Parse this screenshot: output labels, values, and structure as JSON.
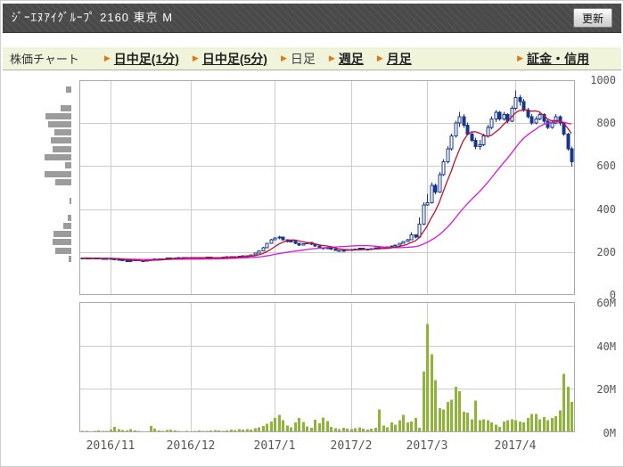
{
  "header": {
    "title": "ｼﾞｰｴﾇｱｲｸﾞﾙｰﾌﾟ 2160 東京 M",
    "refresh_label": "更新"
  },
  "nav": {
    "label": "株価チャート",
    "items": [
      {
        "label": "日中足(1分)",
        "current": false
      },
      {
        "label": "日中足(5分)",
        "current": false
      },
      {
        "label": "日足",
        "current": true
      },
      {
        "label": "週足",
        "current": false
      },
      {
        "label": "月足",
        "current": false
      },
      {
        "label": "証金・信用",
        "current": false
      }
    ]
  },
  "chart_data": {
    "type": "candlestick",
    "title": "",
    "price_axis": {
      "range": [
        0,
        1000
      ],
      "ticks": [
        1000,
        800,
        600,
        400,
        200,
        0
      ],
      "position": "right"
    },
    "volume_axis": {
      "range_millions": [
        0,
        60
      ],
      "ticks": [
        "60M",
        "40M",
        "20M",
        "0M"
      ],
      "tick_values": [
        60,
        40,
        20,
        0
      ],
      "position": "right"
    },
    "x_axis": {
      "month_ticks": [
        {
          "label": "2016/11",
          "index": 7
        },
        {
          "label": "2016/12",
          "index": 27
        },
        {
          "label": "2017/1",
          "index": 48
        },
        {
          "label": "2017/2",
          "index": 67
        },
        {
          "label": "2017/3",
          "index": 86
        },
        {
          "label": "2017/4",
          "index": 108
        }
      ]
    },
    "grid": true,
    "ma_short_window": 7,
    "ma_long_window": 26,
    "colors": {
      "candle": "#17378f",
      "candle_up_fill": "#ffffff",
      "ma_short": "#bb1135",
      "ma_long": "#d818d8",
      "volume_bar": "#8eb43a",
      "hist_bar": "#9c9c9c",
      "grid": "#cccccc",
      "border": "#aaaaaa",
      "axis_text": "#555555"
    },
    "ohlc": [
      [
        172,
        174,
        169,
        171
      ],
      [
        171,
        174,
        168,
        173
      ],
      [
        173,
        174,
        168,
        170
      ],
      [
        170,
        174,
        169,
        172
      ],
      [
        172,
        175,
        168,
        170
      ],
      [
        170,
        172,
        166,
        168
      ],
      [
        168,
        172,
        167,
        171
      ],
      [
        171,
        172,
        167,
        169
      ],
      [
        169,
        170,
        164,
        166
      ],
      [
        166,
        167,
        161,
        163
      ],
      [
        163,
        164,
        157,
        159
      ],
      [
        159,
        160,
        154,
        157
      ],
      [
        157,
        161,
        155,
        160
      ],
      [
        160,
        164,
        159,
        163
      ],
      [
        163,
        164,
        158,
        160
      ],
      [
        160,
        161,
        156,
        158
      ],
      [
        158,
        162,
        157,
        161
      ],
      [
        161,
        166,
        160,
        165
      ],
      [
        165,
        169,
        164,
        168
      ],
      [
        168,
        169,
        163,
        165
      ],
      [
        165,
        170,
        164,
        169
      ],
      [
        169,
        173,
        168,
        172
      ],
      [
        172,
        173,
        167,
        169
      ],
      [
        169,
        174,
        168,
        173
      ],
      [
        173,
        176,
        172,
        175
      ],
      [
        175,
        176,
        170,
        172
      ],
      [
        172,
        176,
        171,
        175
      ],
      [
        175,
        176,
        171,
        173
      ],
      [
        173,
        177,
        172,
        175
      ],
      [
        175,
        176,
        170,
        172
      ],
      [
        172,
        175,
        171,
        174
      ],
      [
        174,
        178,
        173,
        176
      ],
      [
        176,
        177,
        172,
        174
      ],
      [
        174,
        175,
        169,
        171
      ],
      [
        171,
        175,
        170,
        174
      ],
      [
        174,
        178,
        173,
        177
      ],
      [
        177,
        181,
        176,
        179
      ],
      [
        179,
        180,
        174,
        176
      ],
      [
        176,
        180,
        175,
        178
      ],
      [
        178,
        182,
        177,
        180
      ],
      [
        180,
        185,
        179,
        183
      ],
      [
        183,
        184,
        178,
        181
      ],
      [
        181,
        188,
        180,
        186
      ],
      [
        186,
        196,
        185,
        194
      ],
      [
        194,
        208,
        193,
        205
      ],
      [
        205,
        224,
        204,
        220
      ],
      [
        220,
        243,
        219,
        240
      ],
      [
        240,
        262,
        238,
        258
      ],
      [
        258,
        270,
        255,
        265
      ],
      [
        265,
        275,
        260,
        270
      ],
      [
        270,
        272,
        254,
        258
      ],
      [
        258,
        260,
        244,
        248
      ],
      [
        248,
        256,
        245,
        252
      ],
      [
        252,
        253,
        237,
        240
      ],
      [
        240,
        242,
        228,
        232
      ],
      [
        232,
        240,
        230,
        238
      ],
      [
        238,
        247,
        236,
        244
      ],
      [
        244,
        245,
        233,
        236
      ],
      [
        236,
        237,
        225,
        228
      ],
      [
        228,
        229,
        217,
        220
      ],
      [
        220,
        222,
        212,
        215
      ],
      [
        215,
        222,
        213,
        219
      ],
      [
        219,
        220,
        210,
        213
      ],
      [
        213,
        214,
        205,
        208
      ],
      [
        208,
        209,
        201,
        204
      ],
      [
        204,
        210,
        203,
        208
      ],
      [
        208,
        214,
        206,
        212
      ],
      [
        212,
        213,
        207,
        210
      ],
      [
        210,
        215,
        208,
        213
      ],
      [
        213,
        219,
        212,
        217
      ],
      [
        217,
        218,
        211,
        214
      ],
      [
        214,
        215,
        208,
        211
      ],
      [
        211,
        217,
        210,
        215
      ],
      [
        215,
        221,
        214,
        219
      ],
      [
        219,
        220,
        213,
        216
      ],
      [
        216,
        222,
        215,
        220
      ],
      [
        220,
        226,
        219,
        224
      ],
      [
        224,
        230,
        223,
        228
      ],
      [
        228,
        235,
        227,
        233
      ],
      [
        233,
        242,
        232,
        240
      ],
      [
        240,
        250,
        238,
        248
      ],
      [
        248,
        261,
        247,
        258
      ],
      [
        258,
        292,
        256,
        280
      ],
      [
        280,
        283,
        264,
        270
      ],
      [
        270,
        360,
        266,
        330
      ],
      [
        330,
        432,
        326,
        420
      ],
      [
        420,
        470,
        415,
        430
      ],
      [
        430,
        525,
        425,
        510
      ],
      [
        510,
        518,
        468,
        480
      ],
      [
        480,
        572,
        476,
        560
      ],
      [
        560,
        632,
        554,
        620
      ],
      [
        620,
        692,
        612,
        680
      ],
      [
        680,
        752,
        672,
        740
      ],
      [
        740,
        812,
        732,
        800
      ],
      [
        800,
        852,
        782,
        830
      ],
      [
        830,
        842,
        778,
        790
      ],
      [
        790,
        802,
        742,
        750
      ],
      [
        750,
        762,
        712,
        720
      ],
      [
        720,
        732,
        678,
        690
      ],
      [
        690,
        722,
        676,
        700
      ],
      [
        700,
        752,
        692,
        740
      ],
      [
        740,
        792,
        732,
        780
      ],
      [
        780,
        832,
        772,
        820
      ],
      [
        820,
        862,
        806,
        850
      ],
      [
        850,
        856,
        812,
        820
      ],
      [
        820,
        852,
        812,
        840
      ],
      [
        840,
        846,
        798,
        810
      ],
      [
        810,
        882,
        804,
        870
      ],
      [
        870,
        953,
        862,
        920
      ],
      [
        920,
        932,
        882,
        900
      ],
      [
        900,
        912,
        852,
        860
      ],
      [
        860,
        872,
        822,
        830
      ],
      [
        830,
        842,
        792,
        800
      ],
      [
        800,
        832,
        794,
        820
      ],
      [
        820,
        852,
        814,
        840
      ],
      [
        840,
        846,
        798,
        810
      ],
      [
        810,
        816,
        772,
        780
      ],
      [
        780,
        812,
        774,
        800
      ],
      [
        800,
        842,
        794,
        830
      ],
      [
        830,
        836,
        788,
        800
      ],
      [
        800,
        806,
        740,
        750
      ],
      [
        750,
        756,
        672,
        680
      ],
      [
        680,
        690,
        598,
        620
      ]
    ],
    "volumes_millions": [
      0.6,
      0.7,
      0.5,
      0.6,
      0.9,
      0.7,
      0.6,
      1.2,
      2.4,
      1.5,
      1.0,
      0.8,
      1.4,
      0.9,
      0.7,
      0.5,
      0.4,
      2.8,
      1.6,
      0.9,
      0.7,
      1.0,
      1.2,
      0.8,
      0.6,
      0.5,
      0.7,
      0.5,
      0.6,
      0.8,
      0.7,
      0.6,
      0.9,
      1.1,
      0.8,
      0.6,
      0.9,
      1.2,
      1.0,
      1.4,
      1.2,
      1.5,
      1.3,
      1.8,
      2.2,
      2.8,
      4.0,
      5.0,
      6.5,
      8.0,
      5.5,
      3.0,
      2.2,
      4.5,
      6.5,
      4.8,
      2.6,
      2.0,
      5.8,
      4.2,
      6.8,
      5.2,
      2.4,
      1.8,
      1.5,
      2.0,
      1.6,
      1.4,
      1.8,
      2.2,
      1.6,
      1.3,
      1.7,
      2.1,
      10.5,
      3.0,
      2.2,
      4.5,
      3.5,
      5.5,
      8.0,
      4.5,
      5.0,
      6.5,
      2.0,
      28,
      50,
      36,
      24,
      11,
      10.5,
      14,
      15,
      21,
      19,
      9.5,
      9,
      6,
      14.5,
      5.5,
      6,
      5.5,
      4.5,
      3.5,
      2.5,
      5,
      5.5,
      6,
      5.5,
      5,
      4.5,
      6.5,
      8.5,
      8.5,
      6,
      7,
      5.5,
      6.5,
      7.5,
      10,
      27,
      21,
      14
    ],
    "volume_by_price": [
      {
        "price": 956,
        "frac": 0.2
      },
      {
        "price": 871,
        "frac": 0.4
      },
      {
        "price": 832,
        "frac": 0.97
      },
      {
        "price": 794,
        "frac": 0.87
      },
      {
        "price": 757,
        "frac": 0.64
      },
      {
        "price": 718,
        "frac": 0.78
      },
      {
        "price": 678,
        "frac": 0.7
      },
      {
        "price": 641,
        "frac": 1.0
      },
      {
        "price": 602,
        "frac": 0.23
      },
      {
        "price": 562,
        "frac": 1.0
      },
      {
        "price": 525,
        "frac": 0.6
      },
      {
        "price": 438,
        "frac": 0.05
      },
      {
        "price": 359,
        "frac": 0.13
      },
      {
        "price": 322,
        "frac": 0.3
      },
      {
        "price": 284,
        "frac": 0.67
      },
      {
        "price": 245,
        "frac": 0.7
      },
      {
        "price": 207,
        "frac": 0.6
      },
      {
        "price": 168,
        "frac": 0.1
      }
    ]
  }
}
